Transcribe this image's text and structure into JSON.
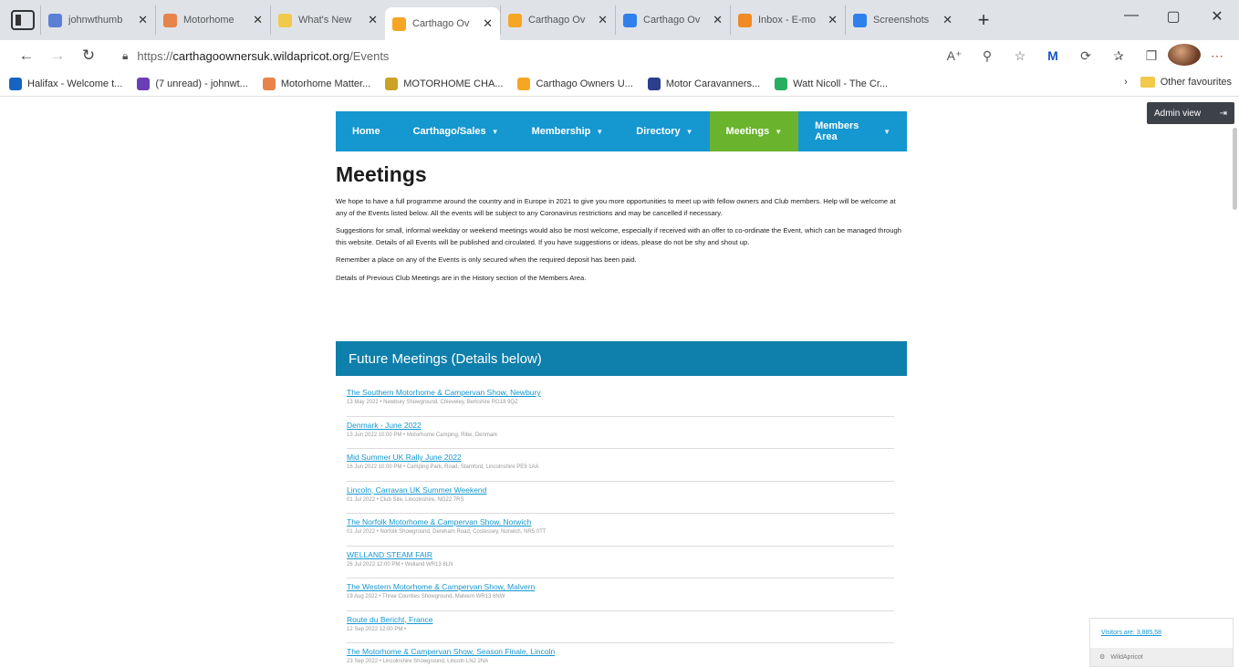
{
  "browser": {
    "tabs": [
      {
        "title": "johnwthumb",
        "color": "#5a7fd6"
      },
      {
        "title": "Motorhome",
        "color": "#e8834a"
      },
      {
        "title": "What's New",
        "color": "#f2c94c"
      },
      {
        "title": "Carthago Ov",
        "color": "#f5a623",
        "active": true
      },
      {
        "title": "Carthago Ov",
        "color": "#f5a623"
      },
      {
        "title": "Carthago Ov",
        "color": "#2f80ed"
      },
      {
        "title": "Inbox - E-mo",
        "color": "#f08a24"
      },
      {
        "title": "Screenshots",
        "color": "#2f80ed"
      }
    ],
    "tab_close": "✕",
    "new_tab": "+",
    "window_controls": {
      "minimize": "—",
      "maximize": "▢",
      "close": "✕"
    },
    "url": {
      "scheme": "https://",
      "host": "carthagoownersuk.wildapricot.org",
      "path": "/Events"
    },
    "favourites": [
      {
        "label": "Halifax - Welcome t...",
        "color": "#1565c0"
      },
      {
        "label": "(7 unread) - johnwt...",
        "color": "#6a3fb5"
      },
      {
        "label": "Motorhome Matter...",
        "color": "#e8834a"
      },
      {
        "label": "MOTORHOME CHA...",
        "color": "#c9a227"
      },
      {
        "label": "Carthago Owners U...",
        "color": "#f5a623"
      },
      {
        "label": "Motor Caravanners...",
        "color": "#2c3e8c"
      },
      {
        "label": "Watt Nicoll - The Cr...",
        "color": "#27ae60"
      }
    ],
    "other_favourites": "Other favourites"
  },
  "admin_view": {
    "label": "Admin view"
  },
  "menu": [
    {
      "label": "Home",
      "caret": false,
      "active": false
    },
    {
      "label": "Carthago/Sales",
      "caret": true,
      "active": false
    },
    {
      "label": "Membership",
      "caret": true,
      "active": false
    },
    {
      "label": "Directory",
      "caret": true,
      "active": false
    },
    {
      "label": "Meetings",
      "caret": true,
      "active": true
    },
    {
      "label": "Members Area",
      "caret": true,
      "active": false
    }
  ],
  "page": {
    "title": "Meetings",
    "intro": [
      "We hope to have a full programme around the country and in Europe in 2021 to give you more opportunities to meet up with fellow owners and Club members. Help will be welcome at any of the Events listed below. All the events will be subject to any Coronavirus restrictions and may be cancelled if necessary.",
      "Suggestions for small, informal weekday or weekend meetings would also be most welcome, especially if received with an offer to co-ordinate the Event, which can be managed through this website. Details of all Events will be published and circulated. If you have suggestions or ideas, please do not be shy and shout up.",
      "Remember a place on any of the Events is only secured when the required deposit has been paid.",
      "Details of Previous Club Meetings are in the History section of the Members Area."
    ],
    "future_header": "Future Meetings (Details below)",
    "events": [
      {
        "title": "The Southern Motorhome & Campervan Show, Newbury",
        "details": "13 May 2022 • Newbury Showground, Chieveley, Berkshire RG18 9QZ"
      },
      {
        "title": "Denmark - June 2022",
        "details": "13 Jun 2022 10:00 PM • Motorhome Camping, Ribe, Denmark"
      },
      {
        "title": "Mid Summer UK Rally June 2022",
        "details": "16 Jun 2022 10:00 PM • Camping Park, Road, Stamford, Lincolnshire PE9 1AA"
      },
      {
        "title": "Lincoln, Carravan UK Summer Weekend",
        "details": "01 Jul 2022 • Club Site, Lincolnshire, NG22 7RS"
      },
      {
        "title": "The Norfolk Motorhome & Campervan Show, Norwich",
        "details": "01 Jul 2022 • Norfolk Showground, Dereham Road, Costessey, Norwich, NR5 0TT"
      },
      {
        "title": "WELLAND STEAM FAIR",
        "details": "26 Jul 2022 12:00 PM • Welland WR13 6LN"
      },
      {
        "title": "The Western Motorhome & Campervan Show, Malvern",
        "details": "19 Aug 2022 • Three Counties Showground, Malvern WR13 6NW"
      },
      {
        "title": "Route du Bericht, France",
        "details": "12 Sep 2022 12:00 PM •"
      },
      {
        "title": "The Motorhome & Campervan Show, Season Finale, Lincoln",
        "details": "23 Sep 2022 • Lincolnshire Showground, Lincoln LN2 2NA"
      }
    ]
  },
  "stats_widget": {
    "link": "Visitors are: 3,885,58",
    "bottom": "WildApricot"
  }
}
